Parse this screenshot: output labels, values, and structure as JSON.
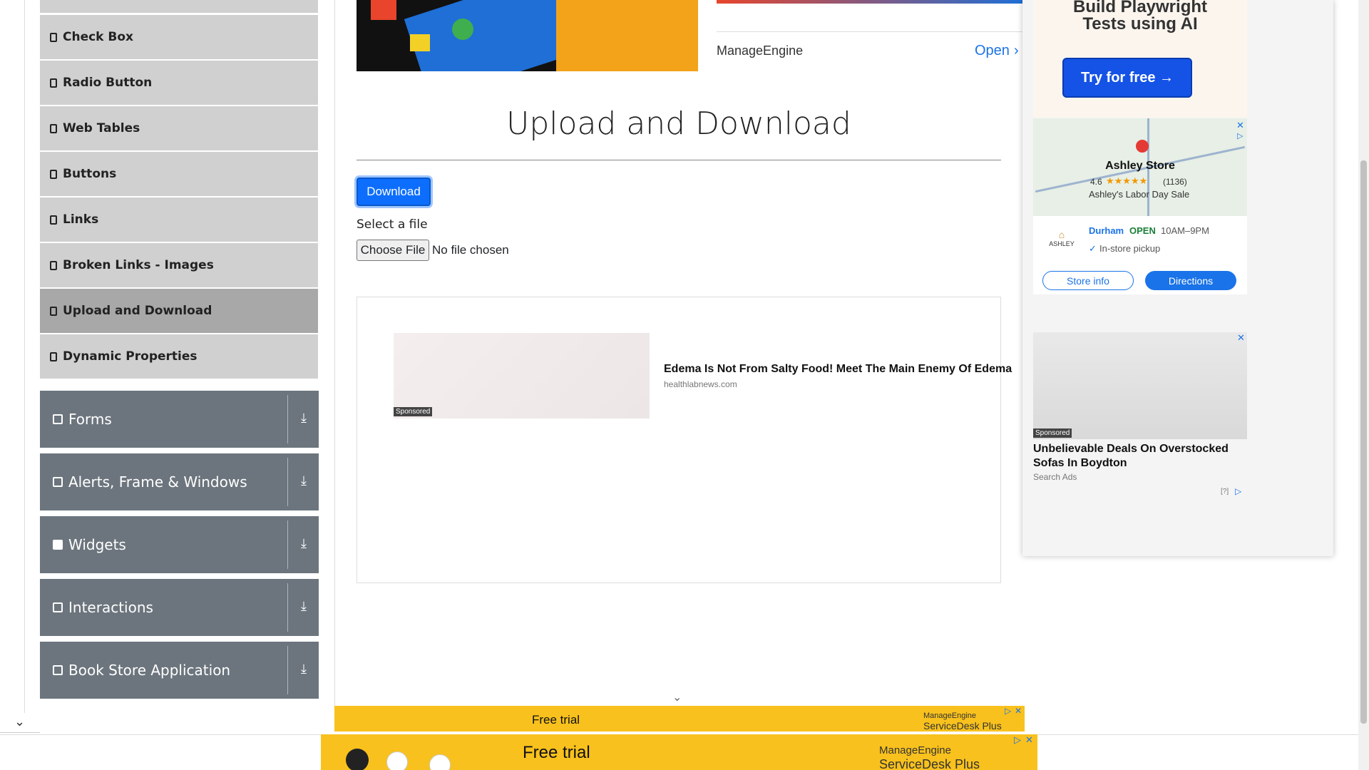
{
  "sidebar": {
    "items": [
      {
        "label": "Check Box"
      },
      {
        "label": "Radio Button"
      },
      {
        "label": "Web Tables"
      },
      {
        "label": "Buttons"
      },
      {
        "label": "Links"
      },
      {
        "label": "Broken Links - Images"
      },
      {
        "label": "Upload and Download"
      },
      {
        "label": "Dynamic Properties"
      }
    ],
    "groups": [
      {
        "label": "Forms"
      },
      {
        "label": "Alerts, Frame & Windows"
      },
      {
        "label": "Widgets"
      },
      {
        "label": "Interactions"
      },
      {
        "label": "Book Store Application"
      }
    ]
  },
  "top_ad": {
    "brand": "ManageEngine",
    "cta": "Open"
  },
  "main": {
    "title": "Upload and Download",
    "download_label": "Download",
    "select_label": "Select a file",
    "choose_label": "Choose File",
    "file_status": "No file chosen"
  },
  "mid_ad": {
    "headline": "Edema Is Not From Salty Food! Meet The Main Enemy Of Edema",
    "source": "healthlabnews.com",
    "sponsored": "Sponsored"
  },
  "right_ad": {
    "promo_line1": "Build Playwright",
    "promo_line2": "Tests using AI",
    "promo_cta": "Try for free →",
    "store_name": "Ashley Store",
    "rating": "4.6",
    "reviews": "(1136)",
    "sale": "Ashley's Labor Day Sale",
    "brand": "ASHLEY",
    "city": "Durham",
    "open": "OPEN",
    "hours": "10AM–9PM",
    "pickup": "In-store pickup",
    "store_info": "Store info",
    "directions": "Directions",
    "sponsored": "Sponsored",
    "ad2_headline": "Unbelievable Deals On Overstocked Sofas In Boydton",
    "ad2_source": "Search Ads",
    "ad2_info": "[?]"
  },
  "bottom_ads": [
    {
      "text": "Free trial",
      "brand_line1": "ManageEngine",
      "brand_line2": "ServiceDesk Plus"
    },
    {
      "text": "Free trial",
      "brand_line1": "ManageEngine",
      "brand_line2": "ServiceDesk Plus"
    }
  ],
  "colors": {
    "primary": "#0d6efd",
    "group_bg": "#6c757d",
    "menu_bg": "#d0d0d0",
    "ad_yellow": "#f8c11d"
  }
}
